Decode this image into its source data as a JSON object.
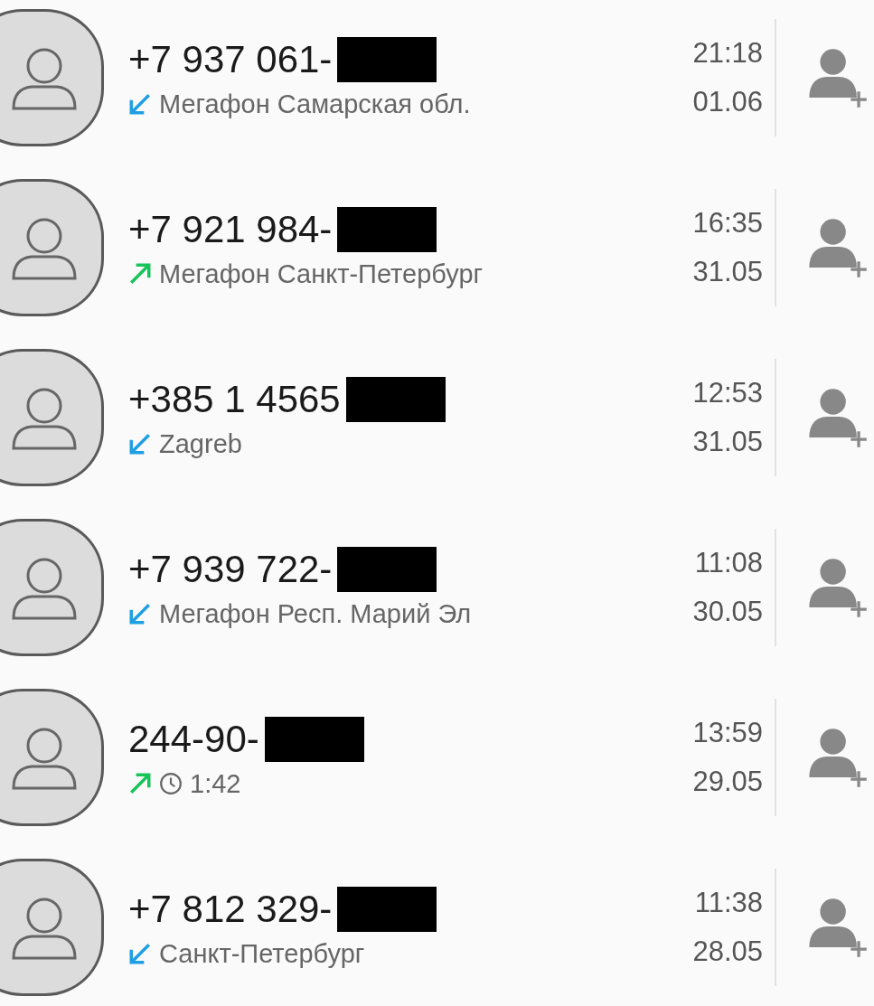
{
  "calls": [
    {
      "number": "+7 937 061-",
      "redacted": true,
      "kind": "incoming",
      "detail": "Мегафон Самарская обл.",
      "time": "21:18",
      "date": "01.06"
    },
    {
      "number": "+7 921 984-",
      "redacted": true,
      "kind": "outgoing",
      "detail": "Мегафон Санкт-Петербург",
      "time": "16:35",
      "date": "31.05"
    },
    {
      "number": "+385 1 4565",
      "redacted": true,
      "kind": "incoming",
      "detail": "Zagreb",
      "time": "12:53",
      "date": "31.05"
    },
    {
      "number": "+7 939 722-",
      "redacted": true,
      "kind": "incoming",
      "detail": "Мегафон Респ. Марий Эл",
      "time": "11:08",
      "date": "30.05"
    },
    {
      "number": "244-90-",
      "redacted": true,
      "kind": "outgoing",
      "duration": true,
      "detail": "1:42",
      "time": "13:59",
      "date": "29.05"
    },
    {
      "number": "+7 812 329-",
      "redacted": true,
      "kind": "incoming",
      "detail": "Санкт-Петербург",
      "time": "11:38",
      "date": "28.05"
    }
  ]
}
